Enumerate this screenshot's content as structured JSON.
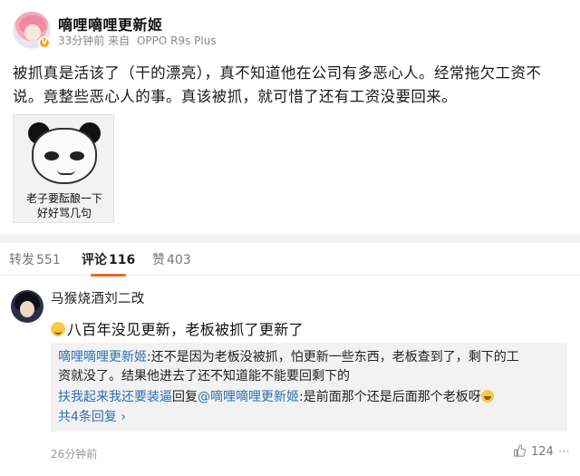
{
  "post": {
    "author": "嘀哩嘀哩更新姬",
    "time": "33分钟前",
    "source_prefix": "来自",
    "device": "OPPO R9s Plus",
    "text_line1": "被抓真是活该了（干的漂亮），真不知道他在公司有多恶心人。经常拖欠工资不",
    "text_line2": "说。竟整些恶心人的事。真该被抓，就可惜了还有工资没要回来。",
    "meme_caption_line1": "老子要酝酿一下",
    "meme_caption_line2": "好好骂几句"
  },
  "tabs": [
    {
      "label": "转发",
      "count": "551"
    },
    {
      "label": "评论",
      "count": "116"
    },
    {
      "label": "赞",
      "count": "403"
    }
  ],
  "comment": {
    "author": "马猴烧酒刘二改",
    "text": "八百年没见更新，老板被抓了更新了",
    "time": "26分钟前",
    "like_count": "124",
    "replies": {
      "r1_author": "嘀哩嘀哩更新姬",
      "r1_text_a": ":还不是因为老板没被抓，怕更新一些东西，老板查到了，剩下的工",
      "r1_text_b": "资就没了。结果他进去了还不知道能不能要回剩下的",
      "r2_author": "扶我起来我还要装逼",
      "r2_reply_word": "回复",
      "r2_mention": "@嘀哩嘀哩更新姬",
      "r2_text": ":是前面那个还是后面那个老板呀",
      "more": "共4条回复",
      "more_arrow": "›"
    }
  },
  "colors": {
    "link": "#2e6fb6",
    "active_tab_underline": "#f26522",
    "verified": "#f5a623"
  }
}
